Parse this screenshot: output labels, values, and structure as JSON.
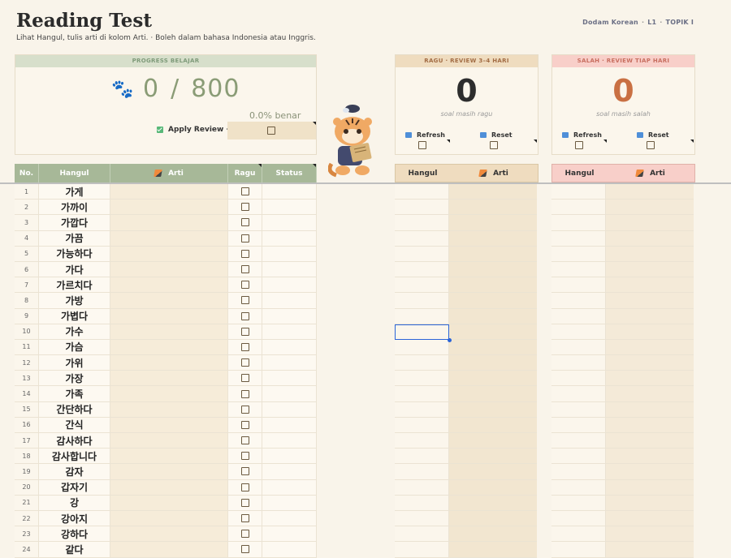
{
  "header": {
    "title": "Reading Test",
    "subtitle": "Lihat Hangul, tulis arti di kolom Arti.  ·  Boleh dalam bahasa Indonesia atau Inggris.",
    "brand": [
      "Dodam Korean",
      "L1",
      "TOPIK I"
    ]
  },
  "progress": {
    "heading": "PROGRESS BELAJAR",
    "done": "0",
    "slash": "/",
    "total": "800",
    "percent_label": "0.0% benar",
    "apply_label": "Apply Review →",
    "icon": "paw-icon"
  },
  "ragu_panel": {
    "heading": "RAGU · REVIEW 3–4 HARI",
    "count": "0",
    "caption": "soal masih ragu",
    "refresh_label": "Refresh",
    "reset_label": "Reset"
  },
  "salah_panel": {
    "heading": "SALAH · REVIEW TIAP HARI",
    "count": "0",
    "caption": "soal masih salah",
    "refresh_label": "Refresh",
    "reset_label": "Reset"
  },
  "table": {
    "headers": {
      "no": "No.",
      "hangul": "Hangul",
      "arti": "Arti",
      "ragu": "Ragu",
      "status": "Status"
    },
    "rows": [
      {
        "no": "1",
        "hangul": "가게"
      },
      {
        "no": "2",
        "hangul": "가까이"
      },
      {
        "no": "3",
        "hangul": "가깝다"
      },
      {
        "no": "4",
        "hangul": "가끔"
      },
      {
        "no": "5",
        "hangul": "가능하다"
      },
      {
        "no": "6",
        "hangul": "가다"
      },
      {
        "no": "7",
        "hangul": "가르치다"
      },
      {
        "no": "8",
        "hangul": "가방"
      },
      {
        "no": "9",
        "hangul": "가볍다"
      },
      {
        "no": "10",
        "hangul": "가수"
      },
      {
        "no": "11",
        "hangul": "가슴"
      },
      {
        "no": "12",
        "hangul": "가위"
      },
      {
        "no": "13",
        "hangul": "가장"
      },
      {
        "no": "14",
        "hangul": "가족"
      },
      {
        "no": "15",
        "hangul": "간단하다"
      },
      {
        "no": "16",
        "hangul": "간식"
      },
      {
        "no": "17",
        "hangul": "감사하다"
      },
      {
        "no": "18",
        "hangul": "감사합니다"
      },
      {
        "no": "19",
        "hangul": "감자"
      },
      {
        "no": "20",
        "hangul": "갑자기"
      },
      {
        "no": "21",
        "hangul": "강"
      },
      {
        "no": "22",
        "hangul": "강아지"
      },
      {
        "no": "23",
        "hangul": "강하다"
      },
      {
        "no": "24",
        "hangul": "같다"
      }
    ]
  },
  "ragu_table": {
    "headers": {
      "hangul": "Hangul",
      "arti": "Arti"
    }
  },
  "salah_table": {
    "headers": {
      "hangul": "Hangul",
      "arti": "Arti"
    }
  },
  "colors": {
    "accent_green": "#a7b898",
    "ragu_tint": "#efdcbf",
    "salah_tint": "#f8cfc9",
    "salah_number": "#c97043",
    "selection": "#2a64d8"
  }
}
